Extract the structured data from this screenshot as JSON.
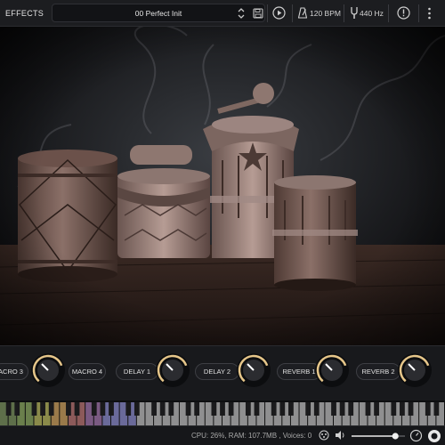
{
  "topbar": {
    "effects_tab": "EFFECTS",
    "preset_name": "00 Perfect Init",
    "tempo": "120 BPM",
    "tuning": "440 Hz",
    "icons": [
      "chevron-updown-icon",
      "save-icon",
      "play-icon",
      "metronome-icon",
      "tuning-fork-icon",
      "info-icon",
      "menu-icon"
    ]
  },
  "macros": {
    "labels": [
      "ACRO 3",
      "MACRO 4",
      "DELAY 1",
      "DELAY 2",
      "REVERB 1",
      "REVERB 2"
    ],
    "knob_levels": [
      0.75,
      0.75,
      0.75,
      0.75,
      0.75,
      0.75
    ]
  },
  "status": {
    "text": "CPU: 26%, RAM: 107.7MB , Voices: 0",
    "volume_level": 0.82,
    "icons": [
      "cpu-icon",
      "speaker-icon",
      "volume-slider",
      "gauge-icon",
      "logo-icon"
    ]
  },
  "colors": {
    "accent": "#e6c68a",
    "panel": "#18191c",
    "topbar": "#1c1d20",
    "text": "#d8d8d8"
  }
}
